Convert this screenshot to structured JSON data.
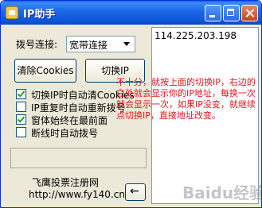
{
  "window": {
    "title": "IP助手"
  },
  "dial": {
    "label": "拨号连接:",
    "selected": "宽带连接"
  },
  "buttons": {
    "clear_cookies": "清除Cookies",
    "switch_ip": "切换IP",
    "back": "←"
  },
  "options": [
    {
      "label": "切换IP时自动清Cookies",
      "checked": true
    },
    {
      "label": "IP重复时自动重新拨号",
      "checked": false
    },
    {
      "label": "窗体始终在最前面",
      "checked": true
    },
    {
      "label": "断线时自动拨号",
      "checked": false
    }
  ],
  "footer": {
    "text": "飞鹰投票注册网",
    "url": "http://www.fy140.cn"
  },
  "log": {
    "ip": "114.225.203.198"
  },
  "annotation": "不十分，就按上面的切换IP，右边的白处就会显示你的IP地址，每换一次就会显示一次，如果IP没变，就继续点切换IP，直接地址改变。",
  "watermark": "Baidu经验",
  "colors": {
    "title_bar": "#0a5ee8",
    "annotation": "#e0141e",
    "window_face": "#ece9d8"
  }
}
